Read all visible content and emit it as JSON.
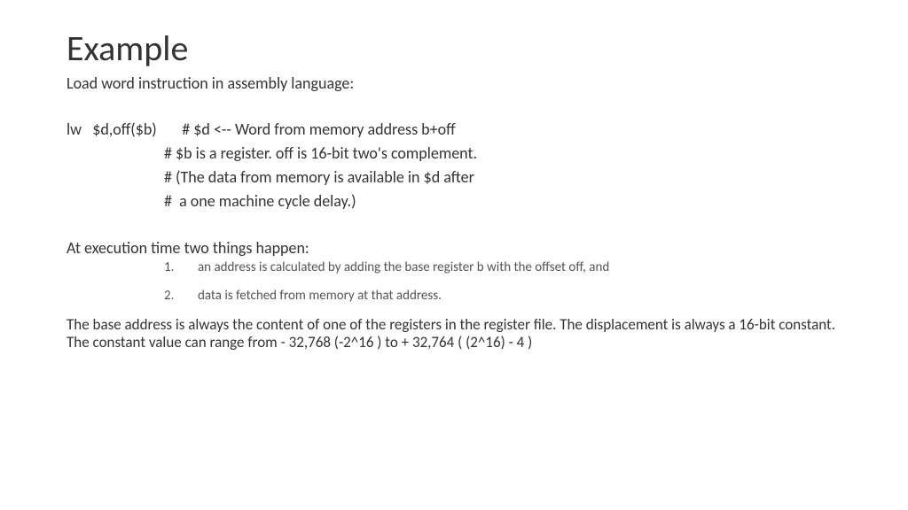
{
  "title": "Example",
  "subtitle": "Load word instruction in assembly language:",
  "code": {
    "line1": "lw   $d,off($b)       # $d <-- Word from memory address b+off",
    "line2": "# $b is a register. off is 16-bit two's complement.",
    "line3": "# (The data from memory is available in $d after",
    "line4": "#  a one machine cycle delay.)"
  },
  "section_heading": "At execution time two things happen:",
  "list": {
    "item1_num": "1.",
    "item1_text": "an address is calculated by adding the base register b with the offset off, and",
    "item2_num": "2.",
    "item2_text": "data is fetched from memory at that address."
  },
  "paragraph": "The base address is always the content of one of the registers in the register file. The displacement is always a 16-bit constant. The constant value can range from - 32,768 (-2^16 ) to + 32,764 ( (2^16) - 4 )"
}
